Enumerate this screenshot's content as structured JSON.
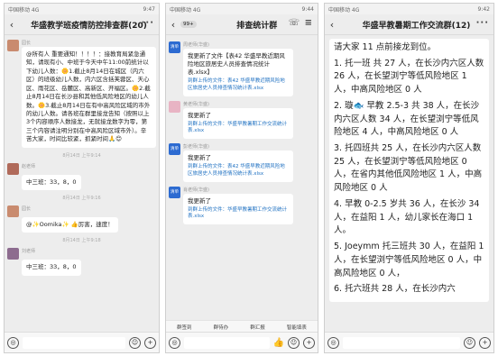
{
  "p1": {
    "status_left": "中国移动 4G",
    "status_right": "9:47",
    "title": "华盛教学班疫情防控排查群(20)",
    "msg1": {
      "sender": "园长",
      "text": "@所有人 重要通知！！！！：接教育局紧急通知，请现有小、中班于今天中午11:00前统计以下幼儿人数：🌼1.截止8月14日在城区（内六区）的班级幼儿人数，内六区含括芙蓉区、天心区、雨花区、岳麓区、高新区、开福区。🌼2.截止8月14日在长沙县和其他低风险地区的幼儿人数。🌼3.截止8月14日在有中高风险区域的市外的幼儿人数。请各班在群里接龙告知（按照以上3个内容顺序人数接龙，无就接龙数字为零，第三个内容请注明分别在中高风险区域市外）。辛苦大家，时间比较紧，抓紧时间🙏😊"
    },
    "time1": "8月14日 上午9:14",
    "msg2": {
      "sender": "赵老师",
      "text": "中三班：33，8，0"
    },
    "time2": "8月14日 上午9:16",
    "msg3": {
      "sender": "园长",
      "text": "@✨Oomika✨ 👍厉害，速度！"
    },
    "time3": "8月14日 上午9:18",
    "msg4": {
      "sender": "刘老师",
      "text": "中三班：33，8，0"
    }
  },
  "p2": {
    "status_left": "中国移动 4G",
    "status_right": "9:44",
    "badge": "99+",
    "title": "排查统计群",
    "a1": {
      "sender": "周老师(华盛)",
      "title": "我更新了文件【表42 华盛早教近期风险地区旅居史人员排查情况统计表.xlsx】",
      "file": "到群上传的文件：表42 华盛早教近期风险地区旅居史人员排查情况统计表.xlsx"
    },
    "a2": {
      "sender": "黄老师(华盛)",
      "title": "我更新了",
      "file": "到群上传的文件：华盛早教暑期工作交流统计表.xlsx"
    },
    "a3": {
      "sender": "彭老师(华盛)",
      "title": "我更新了",
      "file": "到群上传的文件：表42 华盛早教近期风险地区旅居史人员排查情况统计表.xlsx"
    },
    "a4": {
      "sender": "肖老师(华盛)",
      "title": "我更新了",
      "file": "到群上传的文件：华盛早教暑期工作交流统计表.xlsx"
    },
    "avatar_label": "清单",
    "toolbar": [
      "群签到",
      "群待办",
      "群汇报",
      "智能填表"
    ]
  },
  "p3": {
    "status_left": "中国移动 4G",
    "status_right": "9:42",
    "title": "华盛早教暑期工作交流群(12)",
    "lines": [
      "请大家 11 点前接龙到位。",
      "1. 托一班 共 27 人，在长沙内六区人数 26 人，在长望浏宁等低风险地区 1 人，中高风险地区 0 人",
      "2. 璇🐟 早教 2.5-3 共 38 人，在长沙内六区人数 34 人，在长望浏宁等低风险地区 4 人，中高风险地区 0 人",
      "3. 托四班共 25 人，在长沙内六区人数 25 人，在长望浏宁等低风险地区 0 人，在省内其他低风险地区 1 人，中高风险地区 0 人",
      "4. 早教 0-2.5 岁共 36 人，在长沙 34 人，在益阳 1 人，幼儿家长在海口 1 人。",
      "5. Joeymm 托三班共 30 人，在益阳 1 人，在长望浏宁等低风险地区 0 人，中高风险地区 0 人，",
      "6. 托六班共 28 人，在长沙内六"
    ]
  }
}
